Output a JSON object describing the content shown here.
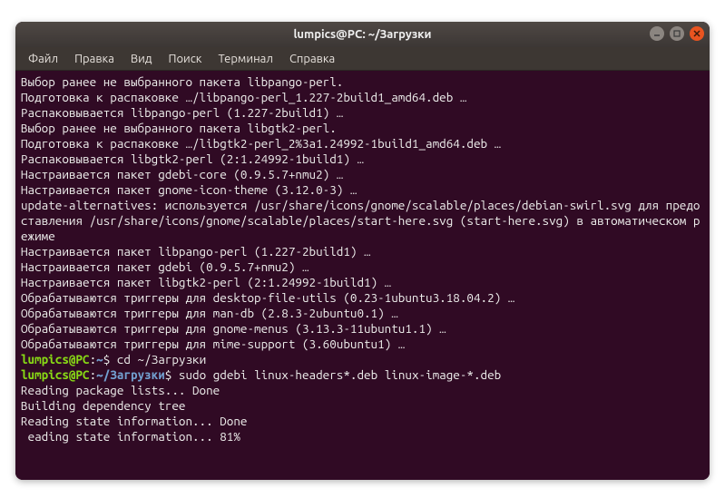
{
  "window": {
    "title": "lumpics@PC: ~/Загрузки"
  },
  "menubar": {
    "items": [
      "Файл",
      "Правка",
      "Вид",
      "Поиск",
      "Терминал",
      "Справка"
    ]
  },
  "terminal": {
    "output_lines": [
      "Выбор ранее не выбранного пакета libpango-perl.",
      "Подготовка к распаковке …/libpango-perl_1.227-2build1_amd64.deb …",
      "Распаковывается libpango-perl (1.227-2build1) …",
      "Выбор ранее не выбранного пакета libgtk2-perl.",
      "Подготовка к распаковке …/libgtk2-perl_2%3a1.24992-1build1_amd64.deb …",
      "Распаковывается libgtk2-perl (2:1.24992-1build1) …",
      "Настраивается пакет gdebi-core (0.9.5.7+nmu2) …",
      "Настраивается пакет gnome-icon-theme (3.12.0-3) …",
      "update-alternatives: используется /usr/share/icons/gnome/scalable/places/debian-swirl.svg для предоставления /usr/share/icons/gnome/scalable/places/start-here.svg (start-here.svg) в автоматическом режиме",
      "Настраивается пакет libpango-perl (1.227-2build1) …",
      "Настраивается пакет gdebi (0.9.5.7+nmu2) …",
      "Настраивается пакет libgtk2-perl (2:1.24992-1build1) …",
      "Обрабатываются триггеры для desktop-file-utils (0.23-1ubuntu3.18.04.2) …",
      "Обрабатываются триггеры для man-db (2.8.3-2ubuntu0.1) …",
      "Обрабатываются триггеры для gnome-menus (3.13.3-11ubuntu1.1) …",
      "Обрабатываются триггеры для mime-support (3.60ubuntu1) …"
    ],
    "prompts": [
      {
        "user": "lumpics",
        "host": "PC",
        "path": "~",
        "command": "cd ~/Загрузки"
      },
      {
        "user": "lumpics",
        "host": "PC",
        "path": "~/Загрузки",
        "command": "sudo gdebi linux-headers*.deb linux-image-*.deb"
      }
    ],
    "tail_lines": [
      "Reading package lists... Done",
      "Building dependency tree",
      "Reading state information... Done",
      " eading state information... 81%"
    ]
  },
  "colors": {
    "terminal_bg": "#300a24",
    "prompt_user": "#88d915",
    "prompt_path": "#729fcf",
    "text": "#eeeeec",
    "close_btn": "#e95420"
  }
}
